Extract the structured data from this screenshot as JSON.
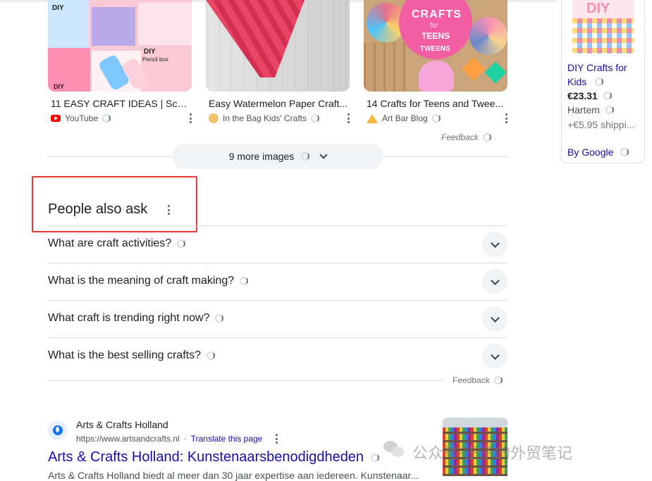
{
  "images": [
    {
      "title": "11 EASY CRAFT IDEAS | Schoo...",
      "source": "YouTube",
      "overlay_texts": [
        "DIY",
        "DIY",
        "Pencil box",
        "DIY"
      ],
      "icon": "youtube-icon"
    },
    {
      "title": "Easy Watermelon Paper Craft...",
      "source": "In the Bag Kids' Crafts",
      "icon": "site-icon"
    },
    {
      "title": "14 Crafts for Teens and Twee...",
      "source": "Art Bar Blog",
      "overlay_texts": [
        "CRAFTS",
        "for",
        "TEENS",
        "TWEENS"
      ],
      "icon": "site-icon"
    }
  ],
  "images_feedback": "Feedback",
  "more_images_label": "9 more images",
  "shopping": {
    "image_text": "DIY",
    "title": "DIY Crafts for Kids",
    "price": "€23.31",
    "store": "Hartem",
    "shipping": "+€5.95 shippi...",
    "by": "By Google"
  },
  "paa": {
    "heading": "People also ask",
    "questions": [
      "What are craft activities?",
      "What is the meaning of craft making?",
      "What craft is trending right now?",
      "What is the best selling crafts?"
    ],
    "feedback": "Feedback"
  },
  "result": {
    "site_name": "Arts & Crafts Holland",
    "url": "https://www.artsandcrafts.nl",
    "translate": "Translate this page",
    "title": "Arts & Crafts Holland: Kunstenaarsbenodigdheden",
    "snippet": "Arts & Crafts Holland biedt al meer dan 30 jaar expertise aan iedereen. Kunstenaar..."
  },
  "watermark": "公众号·王子的外贸笔记",
  "colors": {
    "link": "#1a0dab",
    "highlight_box": "#e53935"
  }
}
